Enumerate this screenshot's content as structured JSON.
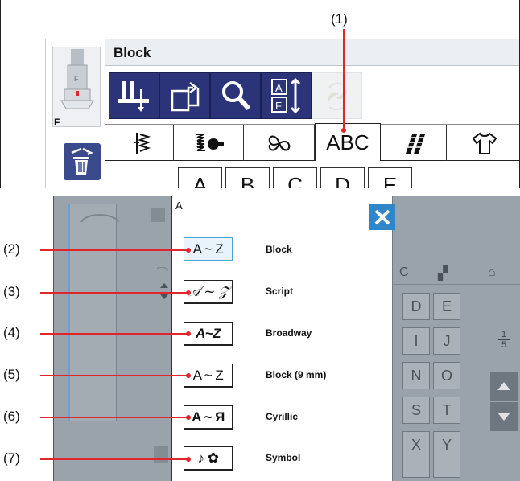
{
  "callouts": [
    "(1)",
    "(2)",
    "(3)",
    "(4)",
    "(5)",
    "(6)",
    "(7)"
  ],
  "top_screen": {
    "presser_foot_label": "F",
    "mode_title": "Block",
    "toolbar_icons": [
      "presser-foot-icon",
      "folder-open-icon",
      "zoom-icon",
      "elongation-icon",
      "mirror-icon"
    ],
    "tabs": [
      {
        "name": "utility-stitch-icon",
        "label": ""
      },
      {
        "name": "satin-stitch-icon",
        "label": ""
      },
      {
        "name": "decorative-stitch-icon",
        "label": ""
      },
      {
        "name": "abc",
        "label": "ABC"
      },
      {
        "name": "pictograph-icon",
        "label": ""
      },
      {
        "name": "shirt-icon",
        "label": ""
      }
    ],
    "letters": [
      "A",
      "B",
      "C",
      "D",
      "E"
    ]
  },
  "bottom_screen": {
    "popup_title": "A",
    "fonts": [
      {
        "button": "A ~ Z",
        "name": "Block"
      },
      {
        "button": "𝒜 ~ 𝒵",
        "name": "Script"
      },
      {
        "button": "A~Z",
        "name": "Broadway"
      },
      {
        "button": "A ~ Z",
        "name": "Block (9 mm)"
      },
      {
        "button": "A ~ Я",
        "name": "Cyrillic"
      },
      {
        "button": "♪ ✿",
        "name": "Symbol"
      }
    ],
    "background_letters": [
      "C",
      "D",
      "E",
      "I",
      "J",
      "N",
      "O",
      "S",
      "T",
      "X",
      "Y"
    ],
    "page_indicator": {
      "current": "1",
      "total": "5"
    }
  },
  "colors": {
    "leader_line": "#e0262a",
    "toolbar_blue": "#2b3478",
    "close_blue": "#2f86c9"
  }
}
